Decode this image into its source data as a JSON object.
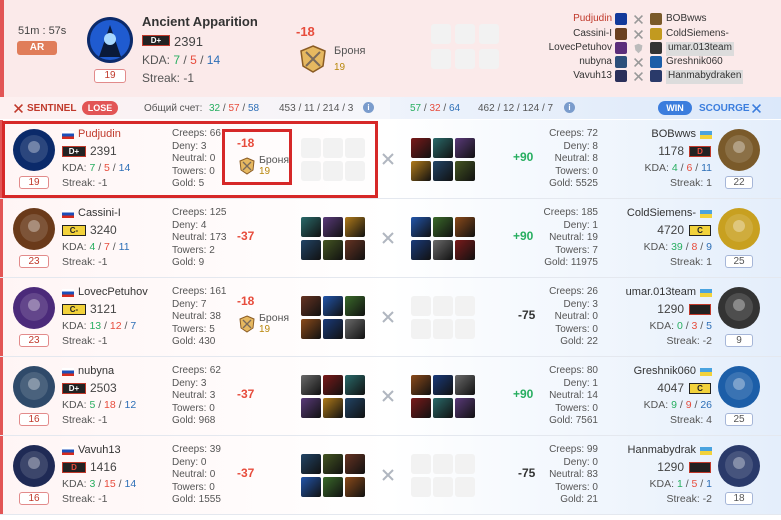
{
  "header": {
    "timer": "51m : 57s",
    "mode": "AR",
    "hero_name": "Ancient Apparition",
    "rank": "D+",
    "mmr": "2391",
    "kda_label": "KDA:",
    "kda": {
      "k": "7",
      "d": "5",
      "a": "14"
    },
    "streak": "Streak: -1",
    "level": "19",
    "mmr_change": "-18",
    "badge_label": "Броня",
    "badge_value": "19",
    "players_left": [
      "Pudjudin",
      "Cassini-I",
      "LovecPetuhov",
      "nubyna",
      "Vavuh13"
    ],
    "players_right": [
      "BOBwws",
      "ColdSiemens-",
      "umar.013team",
      "Greshnik060",
      "Hanmabydraken"
    ]
  },
  "scorebar": {
    "sentinel_label": "SENTINEL",
    "lose_label": "LOSE",
    "total_label": "Общий счет:",
    "left_score": {
      "k": "32",
      "d": "57",
      "a": "58"
    },
    "left_extra": "453 / 11 / 214 / 3",
    "right_score": {
      "k": "57",
      "d": "32",
      "a": "64"
    },
    "right_extra": "462 / 12 / 124 / 7",
    "win_label": "WIN",
    "scourge_label": "SCOURGE"
  },
  "colors": {
    "accent_red": "#e25555",
    "accent_blue": "#3b7ddd",
    "win_green": "#27ae60"
  },
  "labels": {
    "creeps": "Creeps:",
    "deny": "Deny:",
    "neutral": "Neutral:",
    "towers": "Towers:",
    "gold": "Gold:",
    "kda": "KDA:"
  },
  "rows": [
    {
      "left": {
        "name": "Pudjudin",
        "rank": "D+",
        "mmr": "2391",
        "kda": {
          "k": "7",
          "d": "5",
          "a": "14"
        },
        "streak": "Streak: -1",
        "level": "19",
        "creeps": "66",
        "deny": "3",
        "neutral": "0",
        "towers": "0",
        "gold": "5",
        "mmr_change": "-18",
        "badge_label": "Броня",
        "badge_value": "19"
      },
      "net": "+90",
      "right": {
        "name": "BOBwws",
        "rank": "D",
        "mmr": "1178",
        "kda": {
          "k": "4",
          "d": "6",
          "a": "11"
        },
        "streak": "Streak: 1",
        "level": "22",
        "creeps": "72",
        "deny": "8",
        "neutral": "8",
        "towers": "0",
        "gold": "5525"
      }
    },
    {
      "left": {
        "name": "Cassini-I",
        "rank": "C-",
        "mmr": "3240",
        "kda": {
          "k": "4",
          "d": "7",
          "a": "11"
        },
        "streak": "Streak: -1",
        "level": "23",
        "creeps": "125",
        "deny": "4",
        "neutral": "173",
        "towers": "2",
        "gold": "9",
        "mmr_change": "-37"
      },
      "net": "+90",
      "right": {
        "name": "ColdSiemens-",
        "rank": "C",
        "mmr": "4720",
        "kda": {
          "k": "39",
          "d": "8",
          "a": "9"
        },
        "streak": "Streak: 1",
        "level": "25",
        "creeps": "185",
        "deny": "1",
        "neutral": "19",
        "towers": "7",
        "gold": "11975"
      }
    },
    {
      "left": {
        "name": "LovecPetuhov",
        "rank": "C-",
        "mmr": "3121",
        "kda": {
          "k": "13",
          "d": "12",
          "a": "7"
        },
        "streak": "Streak: -1",
        "level": "23",
        "creeps": "161",
        "deny": "7",
        "neutral": "38",
        "towers": "5",
        "gold": "430",
        "mmr_change": "-18",
        "badge_label": "Броня",
        "badge_value": "19"
      },
      "net": "-75",
      "right": {
        "name": "umar.013team",
        "rank": "",
        "mmr": "1290",
        "kda": {
          "k": "0",
          "d": "3",
          "a": "5"
        },
        "streak": "Streak: -2",
        "level": "9",
        "creeps": "26",
        "deny": "3",
        "neutral": "0",
        "towers": "0",
        "gold": "22"
      }
    },
    {
      "left": {
        "name": "nubyna",
        "rank": "D+",
        "mmr": "2503",
        "kda": {
          "k": "5",
          "d": "18",
          "a": "12"
        },
        "streak": "Streak: -1",
        "level": "16",
        "creeps": "62",
        "deny": "3",
        "neutral": "3",
        "towers": "0",
        "gold": "968",
        "mmr_change": "-37"
      },
      "net": "+90",
      "right": {
        "name": "Greshnik060",
        "rank": "C",
        "mmr": "4047",
        "kda": {
          "k": "9",
          "d": "9",
          "a": "26"
        },
        "streak": "Streak: 4",
        "level": "25",
        "creeps": "80",
        "deny": "1",
        "neutral": "14",
        "towers": "0",
        "gold": "7561"
      }
    },
    {
      "left": {
        "name": "Vavuh13",
        "rank": "D",
        "mmr": "1416",
        "kda": {
          "k": "3",
          "d": "15",
          "a": "14"
        },
        "streak": "Streak: -1",
        "level": "16",
        "creeps": "39",
        "deny": "0",
        "neutral": "0",
        "towers": "0",
        "gold": "1555",
        "mmr_change": "-37"
      },
      "net": "-75",
      "right": {
        "name": "Hanmabydrak",
        "rank": "",
        "mmr": "1290",
        "kda": {
          "k": "1",
          "d": "5",
          "a": "1"
        },
        "streak": "Streak: -2",
        "level": "18",
        "creeps": "99",
        "deny": "0",
        "neutral": "83",
        "towers": "0",
        "gold": "21"
      }
    }
  ]
}
